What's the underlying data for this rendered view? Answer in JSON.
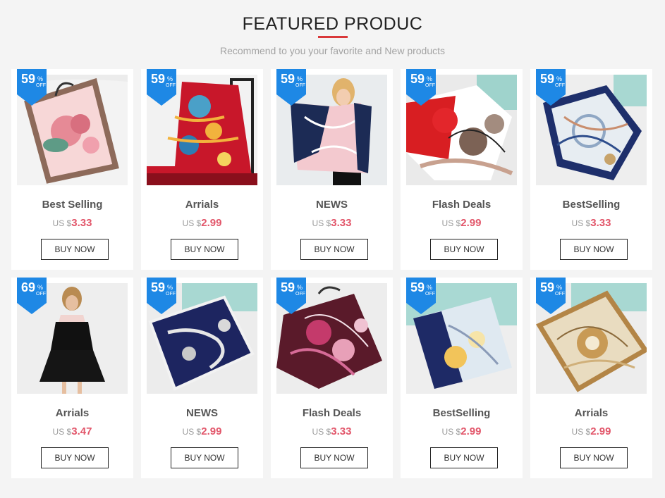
{
  "header": {
    "title": "FEATURED PRODUC",
    "subtitle": "Recommend to you your favorite and New products",
    "accent_color": "#d9383a"
  },
  "badge": {
    "color": "#1e88e5",
    "percent_symbol": "%",
    "off_label": "OFF"
  },
  "products": [
    {
      "name": "Best Selling",
      "currency": "US $",
      "price": "3.33",
      "discount": "59",
      "button": "BUY NOW",
      "image": "pink-rose-scarf-image"
    },
    {
      "name": "Arrials",
      "currency": "US $",
      "price": "2.99",
      "discount": "59",
      "button": "BUY NOW",
      "image": "red-chain-scarf-image"
    },
    {
      "name": "NEWS",
      "currency": "US $",
      "price": "3.33",
      "discount": "59",
      "button": "BUY NOW",
      "image": "model-navy-scarf-image"
    },
    {
      "name": "Flash Deals",
      "currency": "US $",
      "price": "2.99",
      "discount": "59",
      "button": "BUY NOW",
      "image": "red-floral-scarf-image"
    },
    {
      "name": "BestSelling",
      "currency": "US $",
      "price": "3.33",
      "discount": "59",
      "button": "BUY NOW",
      "image": "blue-clock-scarf-image"
    },
    {
      "name": "Arrials",
      "currency": "US $",
      "price": "3.47",
      "discount": "69",
      "button": "BUY NOW",
      "image": "model-black-dress-image"
    },
    {
      "name": "NEWS",
      "currency": "US $",
      "price": "2.99",
      "discount": "59",
      "button": "BUY NOW",
      "image": "navy-chain-scarf-image"
    },
    {
      "name": "Flash Deals",
      "currency": "US $",
      "price": "3.33",
      "discount": "59",
      "button": "BUY NOW",
      "image": "paisley-scarf-image"
    },
    {
      "name": "BestSelling",
      "currency": "US $",
      "price": "2.99",
      "discount": "59",
      "button": "BUY NOW",
      "image": "lily-scarf-image"
    },
    {
      "name": "Arrials",
      "currency": "US $",
      "price": "2.99",
      "discount": "59",
      "button": "BUY NOW",
      "image": "gold-tile-scarf-image"
    }
  ]
}
